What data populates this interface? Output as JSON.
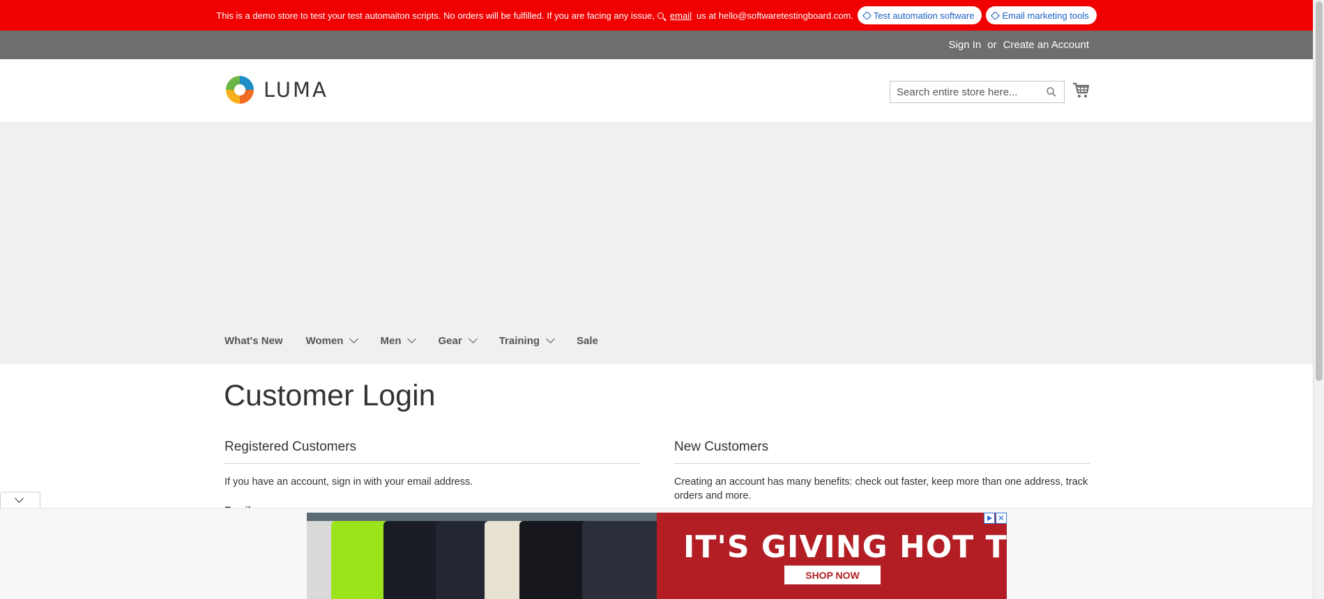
{
  "demo_notice": {
    "text_before": "This is a demo store to test your test automaiton scripts. No orders will be fulfilled. If you are facing any issue,",
    "email_link": "email",
    "text_after": "us at hello@softwaretestingboard.com.",
    "pill_1": "Test automation software",
    "pill_2": "Email marketing tools",
    "bg_color": "#f00000"
  },
  "header_links": {
    "sign_in": "Sign In",
    "or": "or",
    "create_account": "Create an Account"
  },
  "logo": {
    "text": "LUMA",
    "icon": "luma-logo-icon"
  },
  "search": {
    "placeholder": "Search entire store here...",
    "icon": "search-icon"
  },
  "cart": {
    "icon": "cart-icon"
  },
  "nav": {
    "items": [
      {
        "label": "What's New",
        "has_dropdown": false
      },
      {
        "label": "Women",
        "has_dropdown": true
      },
      {
        "label": "Men",
        "has_dropdown": true
      },
      {
        "label": "Gear",
        "has_dropdown": true
      },
      {
        "label": "Training",
        "has_dropdown": true
      },
      {
        "label": "Sale",
        "has_dropdown": false
      }
    ]
  },
  "main": {
    "title": "Customer Login",
    "registered": {
      "heading": "Registered Customers",
      "text": "If you have an account, sign in with your email address.",
      "field_label": "Email"
    },
    "new_customers": {
      "heading": "New Customers",
      "text": "Creating an account has many benefits: check out faster, keep more than one address, track orders and more."
    }
  },
  "ad": {
    "headline_1": "IT'S GIVING",
    "headline_2": "HOT TOPIC",
    "cta": "SHOP NOW",
    "close": "✕",
    "accent": "#b21e24"
  }
}
